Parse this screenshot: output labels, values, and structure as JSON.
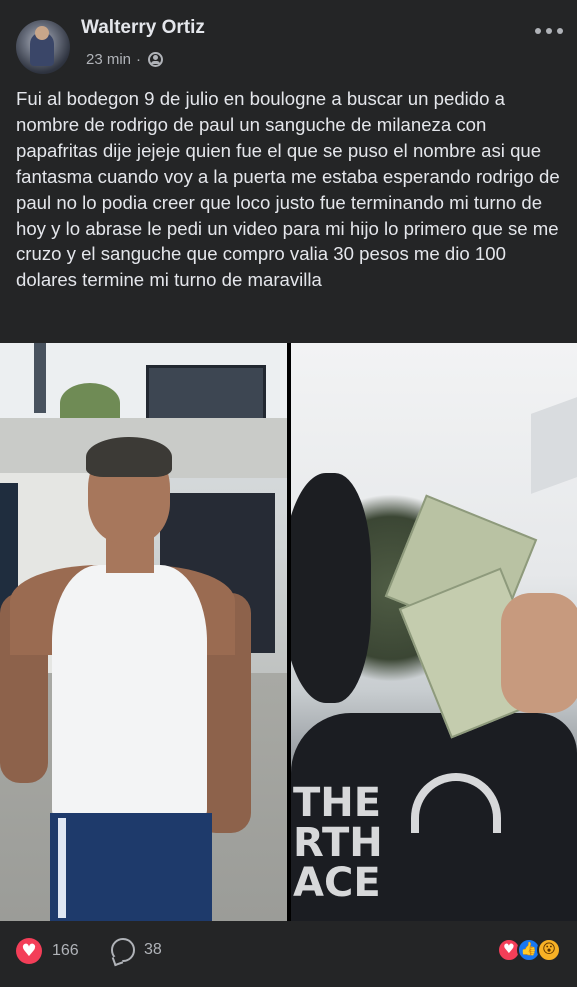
{
  "post": {
    "author": "Walterry Ortiz",
    "time": "23 min",
    "separator": "·",
    "audience_icon": "friends-icon",
    "more_icon": "more-horizontal-icon",
    "text": "Fui al bodegon 9 de julio en boulogne a buscar un pedido a nombre de rodrigo de paul un sanguche de milaneza con papafritas dije jejeje quien fue el que se puso el nombre asi que fantasma cuando voy a la puerta me estaba esperando rodrigo de paul no lo podia creer que loco justo fue terminando mi turno de hoy y lo abrase le pedi un video para mi hijo lo primero que se me cruzo y el sanguche que compro valia 30 pesos me dio 100 dolares termine mi turno de maravilla"
  },
  "photos": {
    "right_logo_text": "THE\nRTH\nACE"
  },
  "footer": {
    "reaction_icon": "heart-icon",
    "reaction_count": "166",
    "comment_icon": "comment-icon",
    "comment_count": "38",
    "reaction_stack": [
      "love",
      "like",
      "wow"
    ],
    "reaction_glyphs": {
      "love": "♥",
      "like": "👍",
      "wow": "😮"
    }
  },
  "colors": {
    "background": "#242526",
    "text": "#e4e6eb",
    "secondary_text": "#b0b3b8",
    "love": "#f33e58",
    "like": "#1877f2",
    "wow": "#f7b125"
  }
}
